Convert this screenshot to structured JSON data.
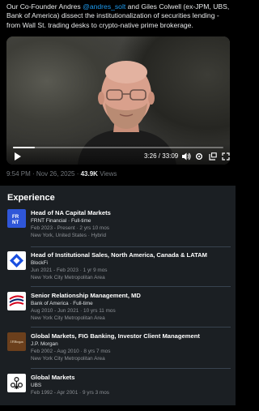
{
  "tweet": {
    "text_before": "Our Co-Founder Andres ",
    "mention": "@andres_solt",
    "text_after": " and Giles Colwell (ex-JPM, UBS, Bank of America) dissect the institutionalization of securities lending - from Wall St. trading desks to crypto-native prime brokerage.",
    "timestamp": "9:54 PM · Nov 26, 2025 · ",
    "views_count": "43.9K",
    "views_label": " Views"
  },
  "video": {
    "time": "3:26 / 33:09",
    "progress_fraction": 0.104,
    "icons": [
      "play-icon",
      "volume-icon",
      "settings-icon",
      "pip-icon",
      "fullscreen-icon"
    ]
  },
  "experience": {
    "title": "Experience",
    "items": [
      {
        "role": "Head of NA Capital Markets",
        "company": "FRNT Financial · Full-time",
        "dates": "Feb 2023 - Present · 2 yrs 10 mos",
        "location": "New York, United States · Hybrid",
        "logo": "FRNT"
      },
      {
        "role": "Head of Institutional Sales, North America, Canada & LATAM",
        "company": "BlockFi",
        "dates": "Jun 2021 - Feb 2023 · 1 yr 9 mos",
        "location": "New York City Metropolitan Area",
        "logo": "blockfi"
      },
      {
        "role": "Senior Relationship Management, MD",
        "company": "Bank of America · Full-time",
        "dates": "Aug 2010 - Jun 2021 · 10 yrs 11 mos",
        "location": "New York City Metropolitan Area",
        "logo": "boa"
      },
      {
        "role": "Global Markets, FIG Banking, Investor Client Management",
        "company": "J.P. Morgan",
        "dates": "Feb 2002 - Aug 2010 · 8 yrs 7 mos",
        "location": "New York City Metropolitan Area",
        "logo": "J.P.Morgan"
      },
      {
        "role": "Global Markets",
        "company": "UBS",
        "dates": "Feb 1992 - Apr 2001 · 9 yrs 3 mos",
        "location": "",
        "logo": "ubs"
      }
    ]
  },
  "colors": {
    "accent": "#1d9bf0",
    "frnt_logo": "#2f56d8",
    "blockfi_logo": "#1a4fe0",
    "boa_red": "#d4001a",
    "boa_blue": "#012169",
    "jpm_logo_bg": "#6b3f1c"
  }
}
